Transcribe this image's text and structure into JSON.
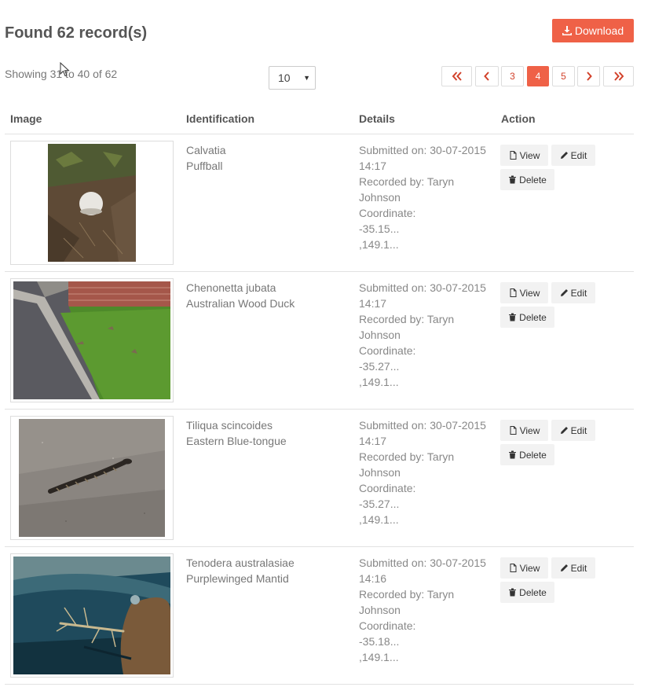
{
  "header": {
    "title": "Found 62 record(s)",
    "download_label": "Download"
  },
  "summary": {
    "showing_text": "Showing 31 to 40 of 62",
    "page_size": "10"
  },
  "pagination": {
    "pages": [
      "3",
      "4",
      "5"
    ],
    "active_page": "4"
  },
  "table": {
    "columns": [
      "Image",
      "Identification",
      "Details",
      "Action"
    ],
    "rows": [
      {
        "scientific_name": "Calvatia",
        "common_name": "Puffball",
        "submitted": "Submitted on: 30-07-2015",
        "time": "14:17",
        "recorded_by": "Recorded by: Taryn",
        "recorder_last": "Johnson",
        "coord_label": "Coordinate:",
        "lat": "-35.15...",
        "lon": ",149.1...",
        "image_subject": "puffball-fungus-photo"
      },
      {
        "scientific_name": "Chenonetta jubata",
        "common_name": "Australian Wood Duck",
        "submitted": "Submitted on: 30-07-2015",
        "time": "14:17",
        "recorded_by": "Recorded by: Taryn",
        "recorder_last": "Johnson",
        "coord_label": "Coordinate:",
        "lat": "-35.27...",
        "lon": ",149.1...",
        "image_subject": "street-kerb-grass-photo"
      },
      {
        "scientific_name": "Tiliqua scincoides",
        "common_name": "Eastern Blue-tongue",
        "submitted": "Submitted on: 30-07-2015",
        "time": "14:17",
        "recorded_by": "Recorded by: Taryn",
        "recorder_last": "Johnson",
        "coord_label": "Coordinate:",
        "lat": "-35.27...",
        "lon": ",149.1...",
        "image_subject": "lizard-on-concrete-photo"
      },
      {
        "scientific_name": "Tenodera australasiae",
        "common_name": "Purplewinged Mantid",
        "submitted": "Submitted on: 30-07-2015",
        "time": "14:16",
        "recorded_by": "Recorded by: Taryn",
        "recorder_last": "Johnson",
        "coord_label": "Coordinate:",
        "lat": "-35.18...",
        "lon": ",149.1...",
        "image_subject": "mantid-on-windscreen-photo"
      }
    ]
  },
  "actions": {
    "view": "View",
    "edit": "Edit",
    "delete": "Delete"
  },
  "icons": {
    "download": "download-icon",
    "first": "double-chevron-left-icon",
    "prev": "chevron-left-icon",
    "next": "chevron-right-icon",
    "last": "double-chevron-right-icon",
    "view": "file-icon",
    "edit": "pencil-icon",
    "delete": "trash-icon"
  },
  "colors": {
    "accent": "#ef6147",
    "pager_text": "#d2412a",
    "button_bg": "#f2f2f2"
  }
}
